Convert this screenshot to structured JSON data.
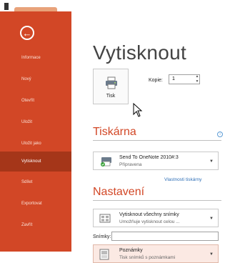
{
  "sidebar": {
    "back_label": "",
    "items": [
      {
        "label": "Informace"
      },
      {
        "label": "Nový"
      },
      {
        "label": "Otevřít"
      },
      {
        "label": "Uložit"
      },
      {
        "label": "Uložit jako"
      },
      {
        "label": "Vytisknout"
      },
      {
        "label": "Sdílet"
      },
      {
        "label": "Exportovat"
      },
      {
        "label": "Zavřít"
      }
    ],
    "active_index": 5
  },
  "main": {
    "title": "Vytisknout",
    "print_button_label": "Tisk",
    "copies_label": "Kopie:",
    "copies_value": "1",
    "printer_heading": "Tiskárna",
    "printer_name": "Send To OneNote 2010#:3",
    "printer_status": "Připravena",
    "printer_properties_link": "Vlastnosti tiskárny",
    "settings_heading": "Nastavení",
    "print_range_title": "Vytisknout všechny snímky",
    "print_range_desc": "Umožňuje vytisknout celou ...",
    "slides_label": "Snímky:",
    "slides_value": "",
    "layout_title": "Poznámky",
    "layout_desc": "Tisk snímků s poznámkami"
  },
  "colors": {
    "accent": "#d24726",
    "active_nav": "#a53619",
    "link": "#2e6fb7"
  }
}
